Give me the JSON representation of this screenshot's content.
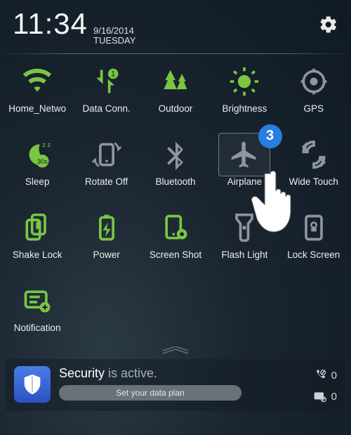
{
  "header": {
    "time": "11:34",
    "date": "9/16/2014",
    "day": "TUESDAY"
  },
  "badge_number": "3",
  "tiles": [
    {
      "label": "Home_Netwo",
      "active": true,
      "name": "wifi-icon"
    },
    {
      "label": "Data Conn.",
      "active": true,
      "name": "data-conn-icon"
    },
    {
      "label": "Outdoor",
      "active": true,
      "name": "outdoor-icon"
    },
    {
      "label": "Brightness",
      "active": true,
      "name": "brightness-icon"
    },
    {
      "label": "GPS",
      "active": false,
      "name": "gps-icon"
    },
    {
      "label": "Sleep",
      "active": true,
      "name": "sleep-icon"
    },
    {
      "label": "Rotate Off",
      "active": false,
      "name": "rotate-icon"
    },
    {
      "label": "Bluetooth",
      "active": false,
      "name": "bluetooth-icon"
    },
    {
      "label": "Airplane",
      "active": false,
      "name": "airplane-icon",
      "selected": true
    },
    {
      "label": "Wide Touch",
      "active": false,
      "name": "wide-touch-icon"
    },
    {
      "label": "Shake Lock",
      "active": true,
      "name": "shake-lock-icon"
    },
    {
      "label": "Power",
      "active": true,
      "name": "power-icon"
    },
    {
      "label": "Screen Shot",
      "active": true,
      "name": "screenshot-icon"
    },
    {
      "label": "Flash Light",
      "active": false,
      "name": "flashlight-icon"
    },
    {
      "label": "Lock Screen",
      "active": false,
      "name": "lock-screen-icon"
    },
    {
      "label": "Notification",
      "active": true,
      "name": "notification-settings-icon"
    }
  ],
  "notification": {
    "title_strong": "Security",
    "title_rest": " is active.",
    "button": "Set your data plan",
    "calls_count": "0",
    "msgs_count": "0"
  }
}
